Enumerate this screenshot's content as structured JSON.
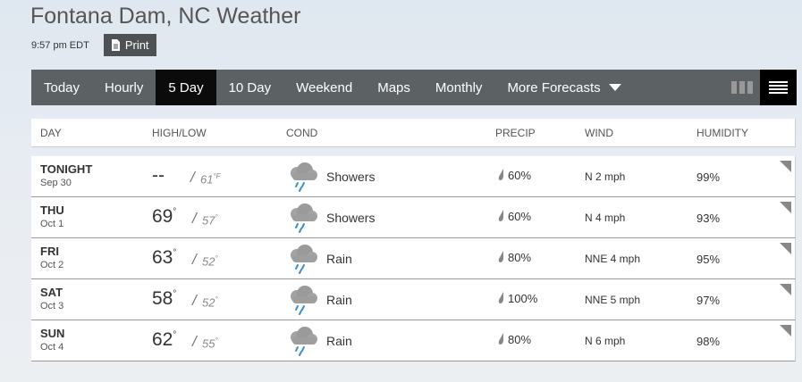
{
  "page": {
    "title": "Fontana Dam, NC Weather",
    "time": "9:57 pm EDT",
    "print_label": "Print"
  },
  "nav": {
    "items": [
      {
        "label": "Today",
        "active": false
      },
      {
        "label": "Hourly",
        "active": false
      },
      {
        "label": "5 Day",
        "active": true
      },
      {
        "label": "10 Day",
        "active": false
      },
      {
        "label": "Weekend",
        "active": false
      },
      {
        "label": "Maps",
        "active": false
      },
      {
        "label": "Monthly",
        "active": false
      }
    ],
    "more_label": "More Forecasts",
    "view_grid_icon": "grid-view-icon",
    "view_list_icon": "list-view-icon"
  },
  "table": {
    "headers": {
      "day": "DAY",
      "highlow": "HIGH/LOW",
      "cond": "COND",
      "precip": "PRECIP",
      "wind": "WIND",
      "humidity": "HUMIDITY"
    },
    "rows": [
      {
        "day": "TONIGHT",
        "date": "Sep 30",
        "high": "--",
        "low": "61",
        "low_unit": "°F",
        "cond": "Showers",
        "precip": "60%",
        "wind": "N 2 mph",
        "humidity": "99%"
      },
      {
        "day": "THU",
        "date": "Oct 1",
        "high": "69",
        "low": "57",
        "cond": "Showers",
        "precip": "60%",
        "wind": "N 4 mph",
        "humidity": "93%"
      },
      {
        "day": "FRI",
        "date": "Oct 2",
        "high": "63",
        "low": "52",
        "cond": "Rain",
        "precip": "80%",
        "wind": "NNE 4 mph",
        "humidity": "95%"
      },
      {
        "day": "SAT",
        "date": "Oct 3",
        "high": "58",
        "low": "52",
        "cond": "Rain",
        "precip": "100%",
        "wind": "NNE 5 mph",
        "humidity": "97%"
      },
      {
        "day": "SUN",
        "date": "Oct 4",
        "high": "62",
        "low": "55",
        "cond": "Rain",
        "precip": "80%",
        "wind": "N 6 mph",
        "humidity": "98%"
      }
    ]
  },
  "colors": {
    "nav_bg": "#5c6264",
    "nav_active": "#0b0b0b",
    "rain_drop": "#3b8fd1",
    "cloud": "#9a9a9a"
  }
}
